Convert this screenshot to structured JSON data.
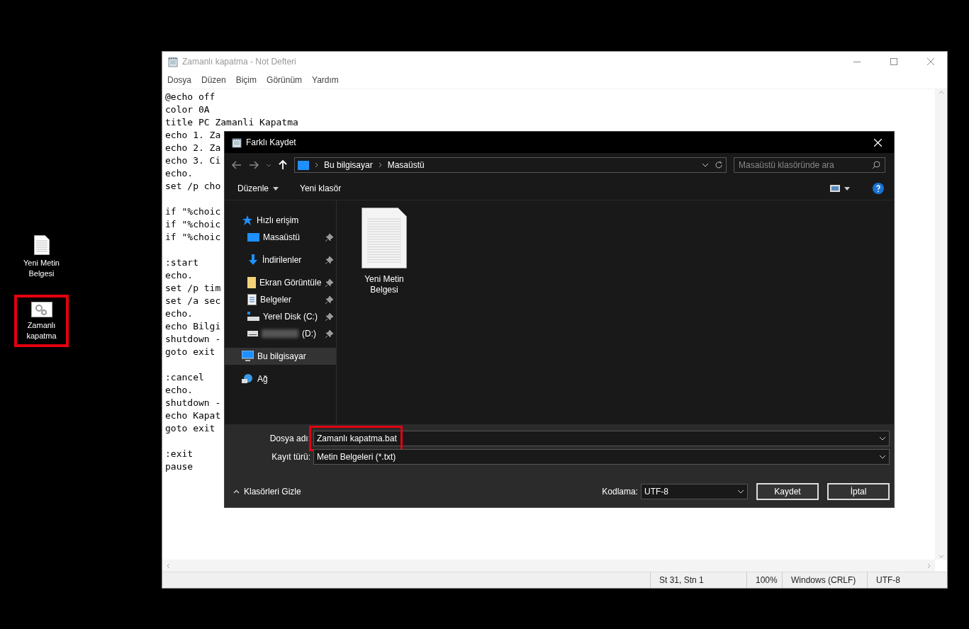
{
  "desktop": {
    "icons": [
      {
        "kind": "text",
        "label": "Yeni Metin Belgesi",
        "highlighted": false
      },
      {
        "kind": "batch",
        "label": "Zamanlı kapatma",
        "highlighted": true
      }
    ]
  },
  "notepad": {
    "title": "Zamanlı kapatma - Not Defteri",
    "menu": [
      "Dosya",
      "Düzen",
      "Biçim",
      "Görünüm",
      "Yardım"
    ],
    "blocks": [
      [
        "@echo off",
        "color 0A",
        "title PC Zamanli Kapatma",
        "echo 1. Za",
        "echo 2. Za",
        "echo 3. Ci",
        "echo.",
        "set /p cho"
      ],
      [
        "if \"%choic",
        "if \"%choic",
        "if \"%choic"
      ],
      [
        ":start",
        "echo.",
        "set /p tim",
        "set /a sec",
        "echo.",
        "echo Bilgi",
        "shutdown -",
        "goto exit"
      ],
      [
        ":cancel",
        "echo.",
        "shutdown -",
        "echo Kapat",
        "goto exit"
      ],
      [
        ":exit",
        "pause"
      ]
    ],
    "status_bar": [
      "St 31, Stn 1",
      "100%",
      "Windows (CRLF)",
      "UTF-8"
    ]
  },
  "dialog": {
    "title": "Farklı Kaydet",
    "breadcrumb": [
      "Bu bilgisayar",
      "Masaüstü"
    ],
    "search": {
      "placeholder": "Masaüstü klasöründe ara"
    },
    "toolbar": {
      "organize": "Düzenle",
      "new_folder": "Yeni klasör"
    },
    "nav": [
      {
        "kind": "quick",
        "label": "Hızlı erişim",
        "selected": false,
        "children": [
          {
            "kind": "desktop",
            "label": "Masaüstü",
            "pinned": true,
            "selected": false
          },
          {
            "kind": "download",
            "label": "İndirilenler",
            "pinned": true,
            "selected": false
          },
          {
            "kind": "folder",
            "label": "Ekran Görüntüle",
            "pinned": true,
            "selected": false
          },
          {
            "kind": "documents",
            "label": "Belgeler",
            "pinned": true,
            "selected": false
          },
          {
            "kind": "disk",
            "label": "Yerel Disk (C:)",
            "pinned": true,
            "selected": false
          },
          {
            "kind": "drive",
            "label": "(D:)",
            "redacted": true,
            "pinned": true,
            "selected": false
          }
        ]
      },
      {
        "kind": "pc",
        "label": "Bu bilgisayar",
        "selected": true
      },
      {
        "kind": "network",
        "label": "Ağ",
        "selected": false
      }
    ],
    "files": [
      {
        "label": "Yeni Metin Belgesi"
      }
    ],
    "file_name": {
      "label": "Dosya adı:",
      "value": "Zamanlı kapatma.bat",
      "highlighted": true
    },
    "file_type": {
      "label": "Kayıt türü:",
      "value": "Metin Belgeleri (*.txt)"
    },
    "hide_folders": "Klasörleri Gizle",
    "encoding": {
      "label": "Kodlama:",
      "value": "UTF-8"
    },
    "buttons": [
      "Kaydet",
      "İptal"
    ]
  }
}
